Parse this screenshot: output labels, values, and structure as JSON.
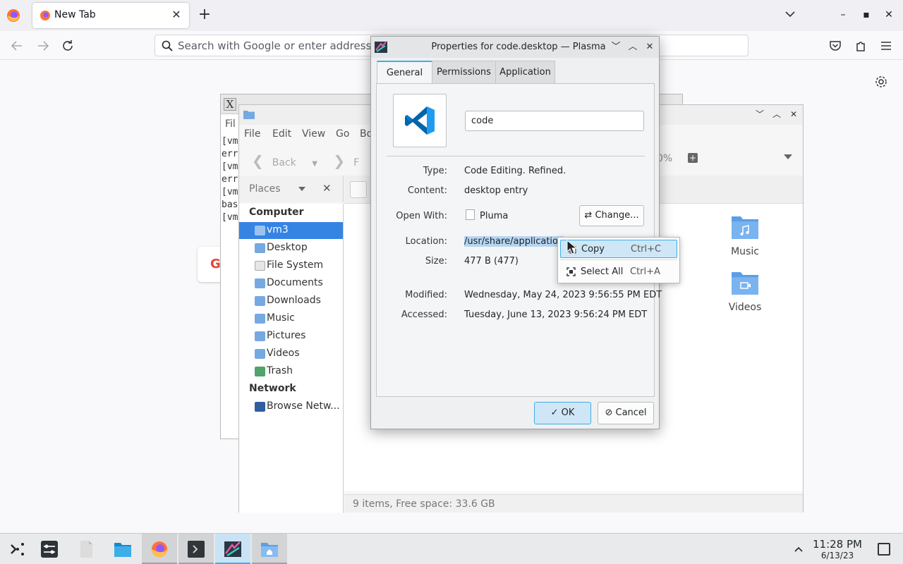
{
  "firefox": {
    "tab_title": "New Tab",
    "urlbar_placeholder": "Search with Google or enter address"
  },
  "xterm": {
    "menu_fragment": "Fil",
    "lines": [
      "[vm",
      "err",
      "[vm",
      "err",
      "[vm",
      "bas",
      "[vm"
    ]
  },
  "file_manager": {
    "menu": [
      "File",
      "Edit",
      "View",
      "Go",
      "Bo"
    ],
    "back_label": "Back",
    "forward_fragment": "F",
    "zoom_fragment": "0%",
    "places_label": "Places",
    "sections": {
      "computer": "Computer",
      "network": "Network"
    },
    "places": [
      {
        "label": "vm3",
        "selected": true
      },
      {
        "label": "Desktop"
      },
      {
        "label": "File System"
      },
      {
        "label": "Documents"
      },
      {
        "label": "Downloads"
      },
      {
        "label": "Music"
      },
      {
        "label": "Pictures"
      },
      {
        "label": "Videos"
      },
      {
        "label": "Trash"
      }
    ],
    "network_items": [
      {
        "label": "Browse Netw..."
      }
    ],
    "folders": [
      {
        "label": "Music"
      },
      {
        "label": "Videos"
      }
    ],
    "status": "9 items, Free space: 33.6 GB"
  },
  "properties_dialog": {
    "title": "Properties for code.desktop — Plasma",
    "tabs": [
      "General",
      "Permissions",
      "Application"
    ],
    "active_tab": "General",
    "name_value": "code",
    "fields": {
      "type_label": "Type:",
      "type_value": "Code Editing. Refined.",
      "content_label": "Content:",
      "content_value": "desktop entry",
      "openwith_label": "Open With:",
      "openwith_value": "Pluma",
      "location_label": "Location:",
      "location_value": "/usr/share/application",
      "size_label": "Size:",
      "size_value": "477 B (477)",
      "modified_label": "Modified:",
      "modified_value": "Wednesday, May 24, 2023 9:56:55 PM EDT",
      "accessed_label": "Accessed:",
      "accessed_value": "Tuesday, June 13, 2023 9:56:24 PM EDT"
    },
    "change_label": "Change...",
    "ok_label": "OK",
    "cancel_label": "Cancel",
    "accent_color": "#3daee9"
  },
  "context_menu": {
    "copy_label": "Copy",
    "copy_shortcut": "Ctrl+C",
    "selectall_label": "Select All",
    "selectall_shortcut": "Ctrl+A"
  },
  "taskbar": {
    "time": "11:28 PM",
    "date": "6/13/23"
  }
}
